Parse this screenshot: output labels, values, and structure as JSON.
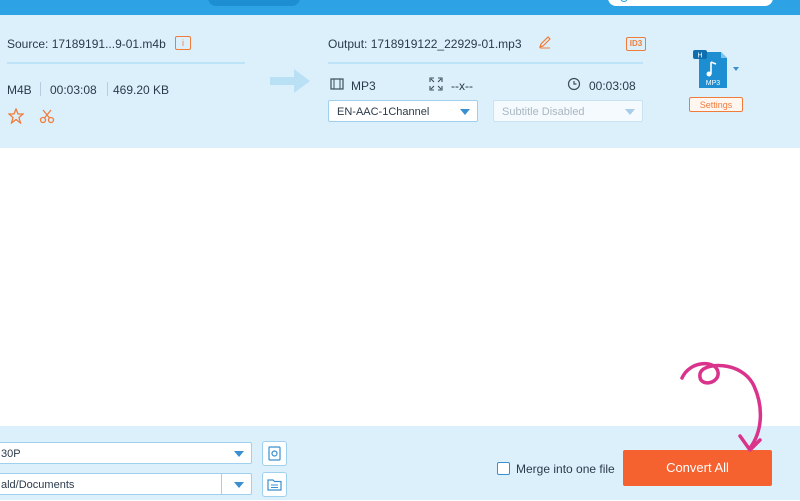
{
  "source": {
    "title": "Source: 17189191...9-01.m4b",
    "format": "M4B",
    "duration": "00:03:08",
    "size": "469.20 KB"
  },
  "output": {
    "title": "Output: 1718919122_22929-01.mp3",
    "format": "MP3",
    "resolution": "--x--",
    "duration": "00:03:08",
    "audio_track": "EN-AAC-1Channel",
    "subtitle": "Subtitle Disabled",
    "format_badge_top": "H",
    "format_badge_label": "MP3",
    "settings_label": "Settings"
  },
  "footer": {
    "output_format_value": "30P",
    "save_to_value": "ald/Documents",
    "merge_label": "Merge into one file",
    "merge_checked": false,
    "convert_label": "Convert All"
  },
  "info_badge": "i",
  "id3_badge": "ID3",
  "colors": {
    "accent_blue": "#2da3e6",
    "panel_bg": "#dcf0fb",
    "orange": "#f5612f",
    "annotation_pink": "#d9338b"
  }
}
